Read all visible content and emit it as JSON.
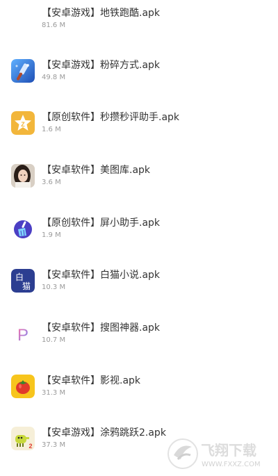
{
  "files": [
    {
      "name": "【安卓游戏】地铁跑酷.apk",
      "size": "81.6 M",
      "icon": "none"
    },
    {
      "name": "【安卓游戏】粉碎方式.apk",
      "size": "49.8 M",
      "icon": "smash-hammer-icon"
    },
    {
      "name": "【原创软件】秒攒秒评助手.apk",
      "size": "1.6 M",
      "icon": "star-z-icon"
    },
    {
      "name": "【安卓软件】美图库.apk",
      "size": "3.6 M",
      "icon": "girl-photo-icon"
    },
    {
      "name": "【原创软件】屏小助手.apk",
      "size": "1.9 M",
      "icon": "broom-icon"
    },
    {
      "name": "【安卓软件】白猫小说.apk",
      "size": "10.3 M",
      "icon": "white-cat-icon"
    },
    {
      "name": "【安卓软件】搜图神器.apk",
      "size": "10.7 M",
      "icon": "p-letter-icon"
    },
    {
      "name": "【安卓软件】影视.apk",
      "size": "31.3 M",
      "icon": "tomato-icon"
    },
    {
      "name": "【安卓游戏】涂鸦跳跃2.apk",
      "size": "37.3 M",
      "icon": "doodle-jump-icon"
    }
  ],
  "icon_glyphs": {
    "white_cat_top": "白",
    "white_cat_bottom": "猫",
    "star_letter": "Z",
    "p_letter": "P",
    "doodle_number": "2"
  },
  "watermark": {
    "title": "飞翔下载",
    "url": "WWW.FXXZ.COM"
  },
  "colors": {
    "text": "#333333",
    "size_text": "#9a9a9a",
    "star_bg": "#f2b63b",
    "cat_bg": "#2c3e91",
    "broom_bg": "#4b3fc4",
    "tomato_bg": "#f7c51d",
    "smash_bg": "#2b6fd6",
    "p_gradient_start": "#ff6fa3",
    "p_gradient_end": "#6d8cff"
  }
}
